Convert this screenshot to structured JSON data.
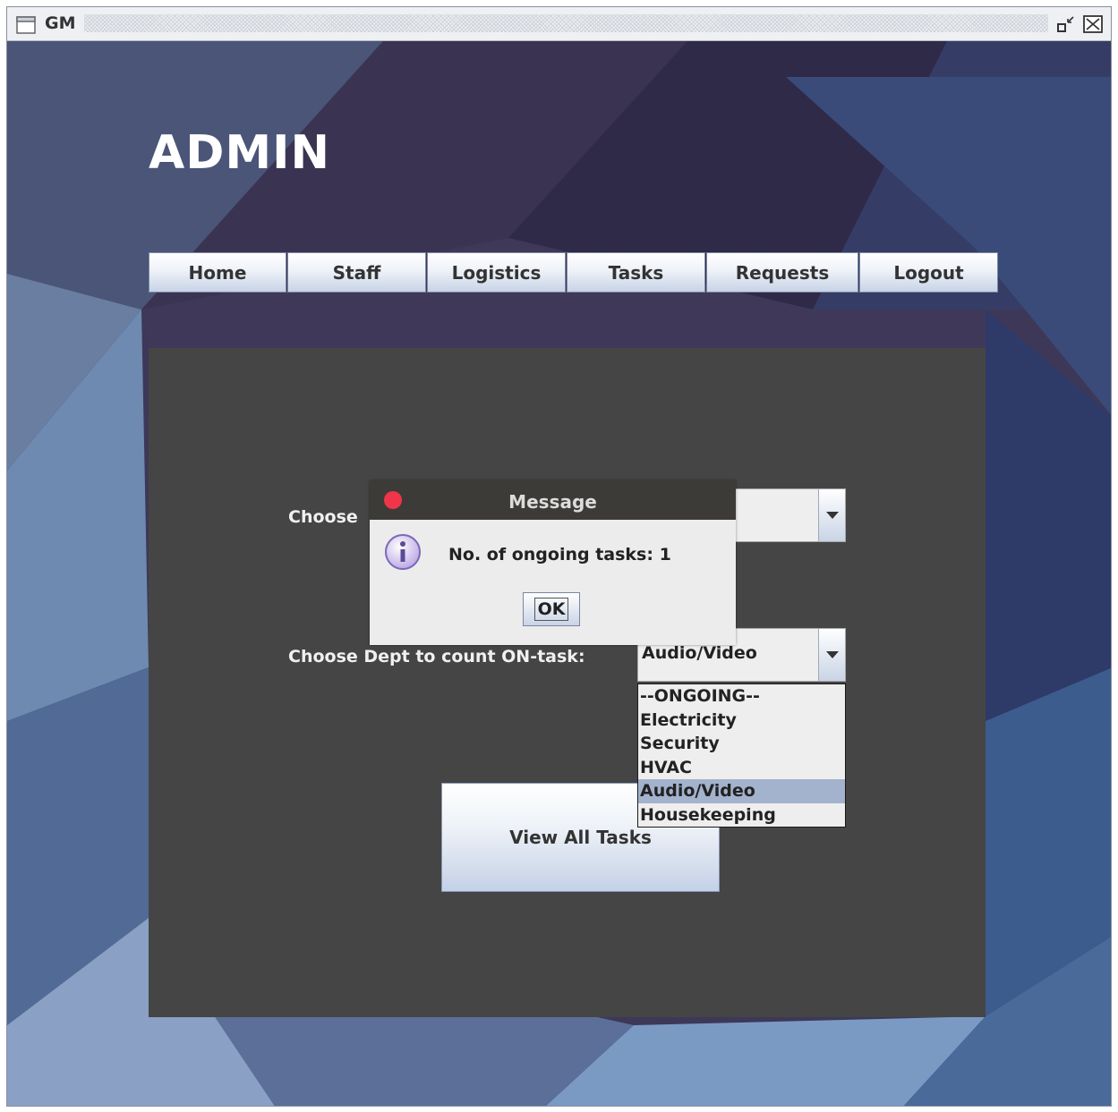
{
  "window": {
    "title": "GM"
  },
  "page": {
    "title": "ADMIN"
  },
  "nav": {
    "items": [
      {
        "label": "Home"
      },
      {
        "label": "Staff"
      },
      {
        "label": "Logistics"
      },
      {
        "label": "Tasks"
      },
      {
        "label": "Requests"
      },
      {
        "label": "Logout"
      }
    ]
  },
  "form": {
    "first_label": "Choose",
    "first_combo_value": "",
    "second_label": "Choose Dept to count ON-task:",
    "second_combo_value": "Audio/Video",
    "options": [
      "--ONGOING--",
      "Electricity",
      "Security",
      "HVAC",
      "Audio/Video",
      "Housekeeping"
    ],
    "selected_option": "Audio/Video",
    "view_all_label": "View All Tasks"
  },
  "dialog": {
    "title": "Message",
    "message": "No. of ongoing tasks: 1",
    "ok_label": "OK",
    "icon": "info-icon"
  },
  "colors": {
    "panel": "#454545",
    "dialog_titlebar": "#3c3b37",
    "dialog_close": "#f0344a",
    "selection": "#a3b3cd"
  }
}
